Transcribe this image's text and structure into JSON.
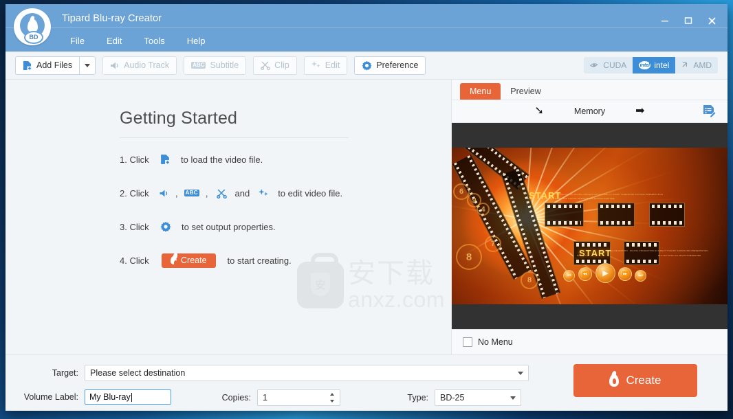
{
  "window": {
    "title": "Tipard Blu-ray Creator",
    "logo_icon": "bluray-flame-logo-icon",
    "controls": {
      "minimize": "minimize-icon",
      "maximize": "maximize-icon",
      "close": "close-icon"
    }
  },
  "menubar": {
    "items": [
      {
        "label": "File"
      },
      {
        "label": "Edit"
      },
      {
        "label": "Tools"
      },
      {
        "label": "Help"
      }
    ]
  },
  "toolbar": {
    "add_files": {
      "label": "Add Files",
      "icon": "add-file-icon",
      "enabled": true
    },
    "add_files_caret": "chevron-down-icon",
    "audio_track": {
      "label": "Audio Track",
      "icon": "speaker-icon",
      "enabled": false
    },
    "subtitle": {
      "label": "Subtitle",
      "icon": "abc-icon",
      "enabled": false
    },
    "clip": {
      "label": "Clip",
      "icon": "scissors-icon",
      "enabled": false
    },
    "edit": {
      "label": "Edit",
      "icon": "sparkle-icon",
      "enabled": false
    },
    "preference": {
      "label": "Preference",
      "icon": "gear-icon",
      "enabled": true
    },
    "accelerators": [
      {
        "label": "CUDA",
        "icon": "nvidia-icon",
        "active": false
      },
      {
        "label": "intel",
        "icon": "intel-icon",
        "active": true
      },
      {
        "label": "AMD",
        "icon": "amd-icon",
        "active": false
      }
    ],
    "accent_active_color": "#3d8ed6"
  },
  "getting_started": {
    "title": "Getting Started",
    "steps": [
      {
        "number": "1. Click",
        "icons": [
          "add-file-icon"
        ],
        "text": "to load the video file."
      },
      {
        "number": "2. Click",
        "icons": [
          "speaker-icon",
          "abc-icon",
          "scissors-icon",
          "sparkle-icon"
        ],
        "conjunction": "and",
        "separator": ",",
        "text": "to edit video file."
      },
      {
        "number": "3. Click",
        "icons": [
          "gear-icon"
        ],
        "text": "to set output properties."
      },
      {
        "number": "4. Click",
        "button_label": "Create",
        "button_icon": "flame-icon",
        "text": "to start creating."
      }
    ]
  },
  "watermark": {
    "cn_text": "安下载",
    "en_text": "anxz.com",
    "icon": "bag-shield-icon"
  },
  "right_panel": {
    "tabs": [
      {
        "label": "Menu",
        "active": true
      },
      {
        "label": "Preview",
        "active": false
      }
    ],
    "active_tab_color": "#e8653a",
    "template_nav": {
      "prev_icon": "arrow-left-icon",
      "name": "Memory",
      "next_icon": "arrow-right-icon",
      "edit_icon": "edit-menu-icon"
    },
    "poster": {
      "start_label_top": "START",
      "start_label_mid": "START",
      "reel_digits": [
        "6",
        "9",
        "4",
        "8",
        "7",
        "8"
      ],
      "playback_icons": [
        "skip-back-icon",
        "rewind-icon",
        "play-icon",
        "fast-forward-icon",
        "skip-forward-icon"
      ]
    },
    "no_menu": {
      "label": "No Menu",
      "checked": false
    }
  },
  "bottom": {
    "target": {
      "label": "Target:",
      "value": "Please select destination"
    },
    "volume_label": {
      "label": "Volume Label:",
      "value": "My Blu-ray"
    },
    "copies": {
      "label": "Copies:",
      "value": "1"
    },
    "type": {
      "label": "Type:",
      "value": "BD-25"
    },
    "create": {
      "label": "Create",
      "icon": "flame-icon",
      "color": "#e8653a"
    }
  }
}
